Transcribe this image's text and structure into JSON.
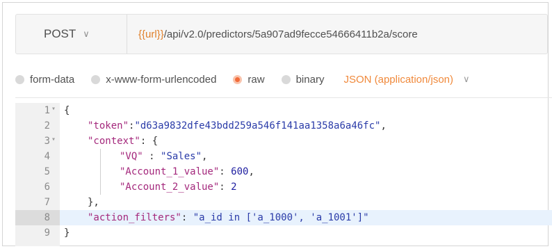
{
  "request": {
    "method": "POST",
    "url_variable": "{{url}}",
    "url_path": "/api/v2.0/predictors/5a907ad9fecce54666411b2a/score"
  },
  "body_options": [
    {
      "label": "form-data",
      "selected": false
    },
    {
      "label": "x-www-form-urlencoded",
      "selected": false
    },
    {
      "label": "raw",
      "selected": true
    },
    {
      "label": "binary",
      "selected": false
    }
  ],
  "content_type": "JSON (application/json)",
  "colors": {
    "accent": "#f26b3a",
    "url_variable": "#e0802c",
    "json_key": "#a4287c",
    "json_string": "#2a3ba8"
  },
  "editor": {
    "lines": [
      {
        "n": "1",
        "fold": true
      },
      {
        "n": "2",
        "fold": false,
        "key": "\"token\"",
        "sep": ":",
        "value": "\"d63a9832dfe43bdd259a546f141aa1358a6a46fc\"",
        "tail": ","
      },
      {
        "n": "3",
        "fold": true,
        "key": "\"context\"",
        "sep": ": ",
        "tail": "{"
      },
      {
        "n": "4",
        "fold": false,
        "key": "\"VQ\"",
        "sep": " : ",
        "value": "\"Sales\"",
        "tail": ","
      },
      {
        "n": "5",
        "fold": false,
        "key": "\"Account_1_value\"",
        "sep": ": ",
        "value": "600",
        "tail": ","
      },
      {
        "n": "6",
        "fold": false,
        "key": "\"Account_2_value\"",
        "sep": ": ",
        "value": "2",
        "tail": ""
      },
      {
        "n": "7",
        "fold": false,
        "tail": "},"
      },
      {
        "n": "8",
        "fold": false,
        "key": "\"action_filters\"",
        "sep": ": ",
        "value": "\"a_id in ['a_1000', 'a_1001']\"",
        "tail": ""
      },
      {
        "n": "9",
        "fold": false,
        "tail": "}"
      }
    ],
    "open_brace": "{",
    "fold_glyph": "▾"
  }
}
